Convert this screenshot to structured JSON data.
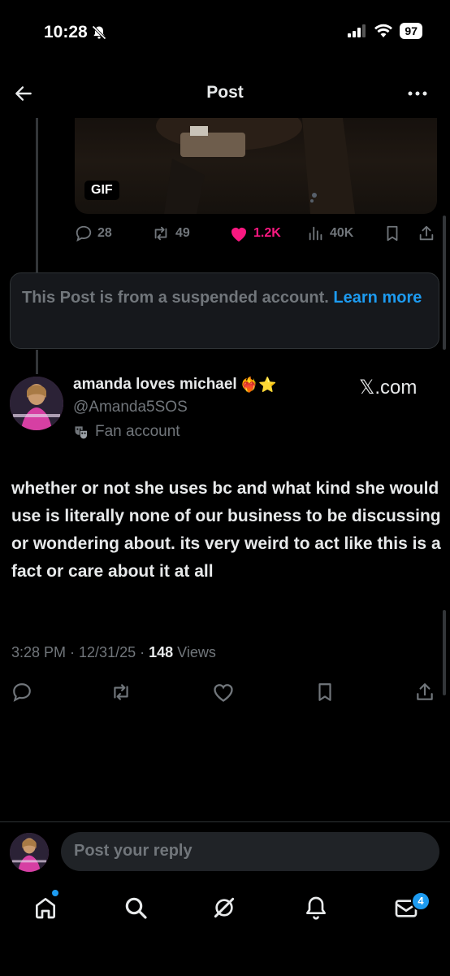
{
  "status_bar": {
    "time": "10:28",
    "battery": "97"
  },
  "header": {
    "title": "Post"
  },
  "quoted_post": {
    "gif_badge": "GIF",
    "actions": {
      "replies": "28",
      "reposts": "49",
      "likes": "1.2K",
      "views": "40K"
    }
  },
  "notice": {
    "text": "This Post is from a suspended account.",
    "link": "Learn more"
  },
  "post": {
    "display_name": "amanda loves michael",
    "name_emojis": "❤️‍🔥⭐",
    "handle": "@Amanda5SOS",
    "label": "Fan account",
    "source": "𝕏.com",
    "text": "whether or not she uses bc and what kind she would use is literally none of our business to be discussing or wondering about. its very weird to act like this is a fact or care about it at all",
    "timestamp": "3:28 PM · 12/31/25 · ",
    "views_count": "148",
    "views_label": " Views"
  },
  "reply": {
    "placeholder": "Post your reply"
  },
  "bottom_nav": {
    "messages_badge": "4"
  },
  "colors": {
    "accent": "#1d9bf0",
    "like": "#f91880",
    "muted": "#71767b",
    "background": "#000000"
  }
}
